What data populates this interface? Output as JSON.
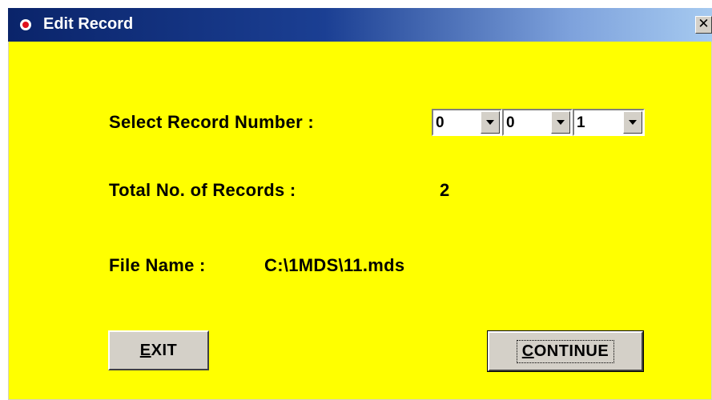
{
  "window": {
    "title": "Edit Record",
    "close_glyph": "✕"
  },
  "form": {
    "select_label": "Select Record Number :",
    "digits": [
      "0",
      "0",
      "1"
    ],
    "total_label": "Total No. of Records :",
    "total_value": "2",
    "file_label": "File Name :",
    "file_value": "C:\\1MDS\\11.mds"
  },
  "buttons": {
    "exit_mnemonic": "E",
    "exit_rest": "XIT",
    "continue_mnemonic": "C",
    "continue_rest": "ONTINUE"
  },
  "colors": {
    "client_bg": "#ffff00",
    "titlebar": "#0a246a",
    "button_face": "#d4d0c8"
  },
  "icons": {
    "title": "record-dot-icon",
    "close": "close-icon",
    "dropdown": "chevron-down-icon"
  }
}
